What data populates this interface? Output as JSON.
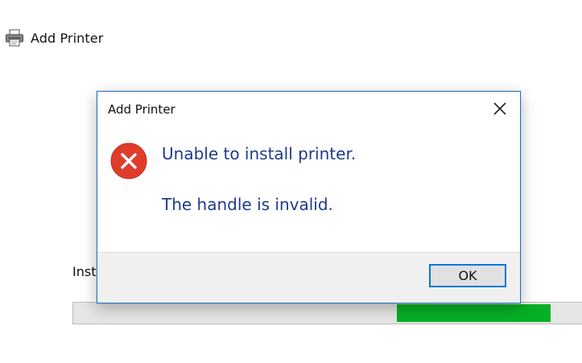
{
  "background_window": {
    "title": "Add Printer",
    "icon": "printer-icon",
    "status_label": "Inst",
    "progress": {
      "visible_fill_start_fraction": 0.63,
      "visible_fill_end_fraction": 0.93,
      "fill_color": "#06b025",
      "track_color": "#e6e6e6"
    }
  },
  "dialog": {
    "title": "Add Printer",
    "close_icon": "close-icon",
    "error_icon": "error-icon",
    "message": "Unable to install printer.",
    "detail": "The handle is invalid.",
    "ok_label": "OK",
    "accent_color": "#0078d7",
    "error_color": "#e03c2c",
    "text_color": "#1e3b8a"
  }
}
